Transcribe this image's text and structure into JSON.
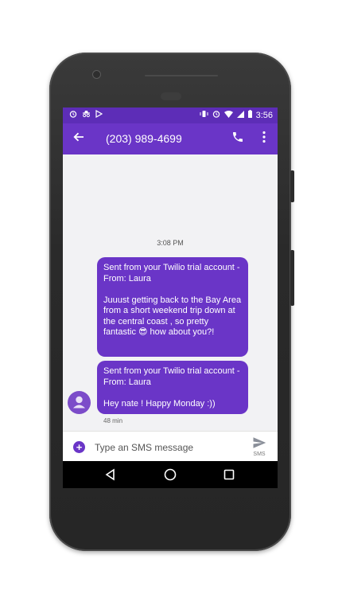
{
  "status_bar": {
    "time": "3:56"
  },
  "app_bar": {
    "title": "(203) 989-4699"
  },
  "conversation": {
    "timestamp": "3:08 PM",
    "messages": [
      {
        "text": "Sent from your Twilio trial account - From: Laura\n\n    Juuust getting back to the Bay Area from a short weekend trip down at the central coast , so pretty fantastic 😎 how about you?!"
      },
      {
        "text": "Sent from your Twilio trial account - From: Laura\n\n    Hey nate ! Happy Monday :))"
      }
    ],
    "age": "48 min"
  },
  "composer": {
    "placeholder": "Type an SMS message",
    "send_label": "SMS"
  },
  "colors": {
    "status_bar": "#5d2db7",
    "app_bar": "#6a35c7",
    "bubble": "#6a35c7",
    "conversation_bg": "#f2f2f4"
  },
  "icons": [
    "alarm-icon",
    "incognito-icon",
    "play-store-icon",
    "vibrate-icon",
    "wifi-icon",
    "signal-icon",
    "battery-icon",
    "back-arrow-icon",
    "phone-icon",
    "more-vert-icon",
    "avatar-person-icon",
    "add-circle-icon",
    "send-icon",
    "nav-back-icon",
    "nav-home-icon",
    "nav-recents-icon"
  ]
}
